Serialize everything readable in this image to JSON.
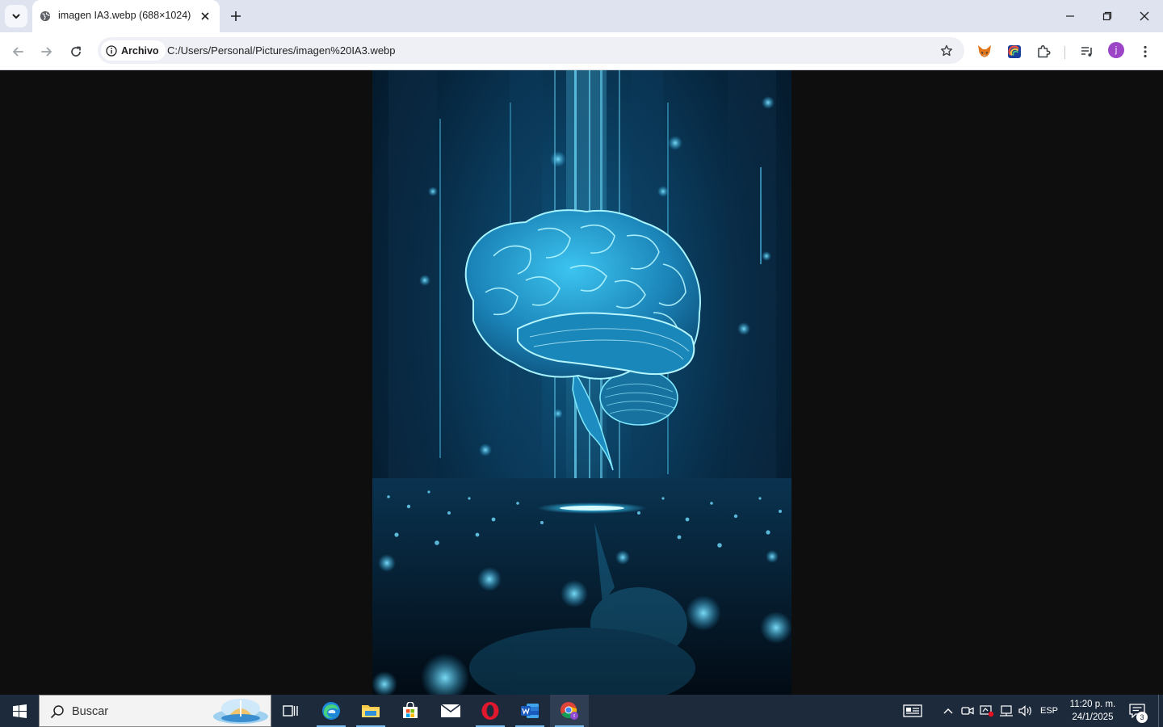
{
  "browser": {
    "tab": {
      "title": "imagen IA3.webp (688×1024)"
    },
    "site_chip_label": "Archivo",
    "url": "C:/Users/Personal/Pictures/imagen%20IA3.webp",
    "profile_initial": "j"
  },
  "taskbar": {
    "search_placeholder": "Buscar",
    "language": "ESP",
    "time": "11:20 p. m.",
    "date": "24/1/2025",
    "notifications_count": "3"
  },
  "colors": {
    "accent": "#76b9ed",
    "taskbar_bg": "#1c2a3b",
    "tab_strip_bg": "#dfe3f0",
    "glow": "#4fd8ff"
  }
}
